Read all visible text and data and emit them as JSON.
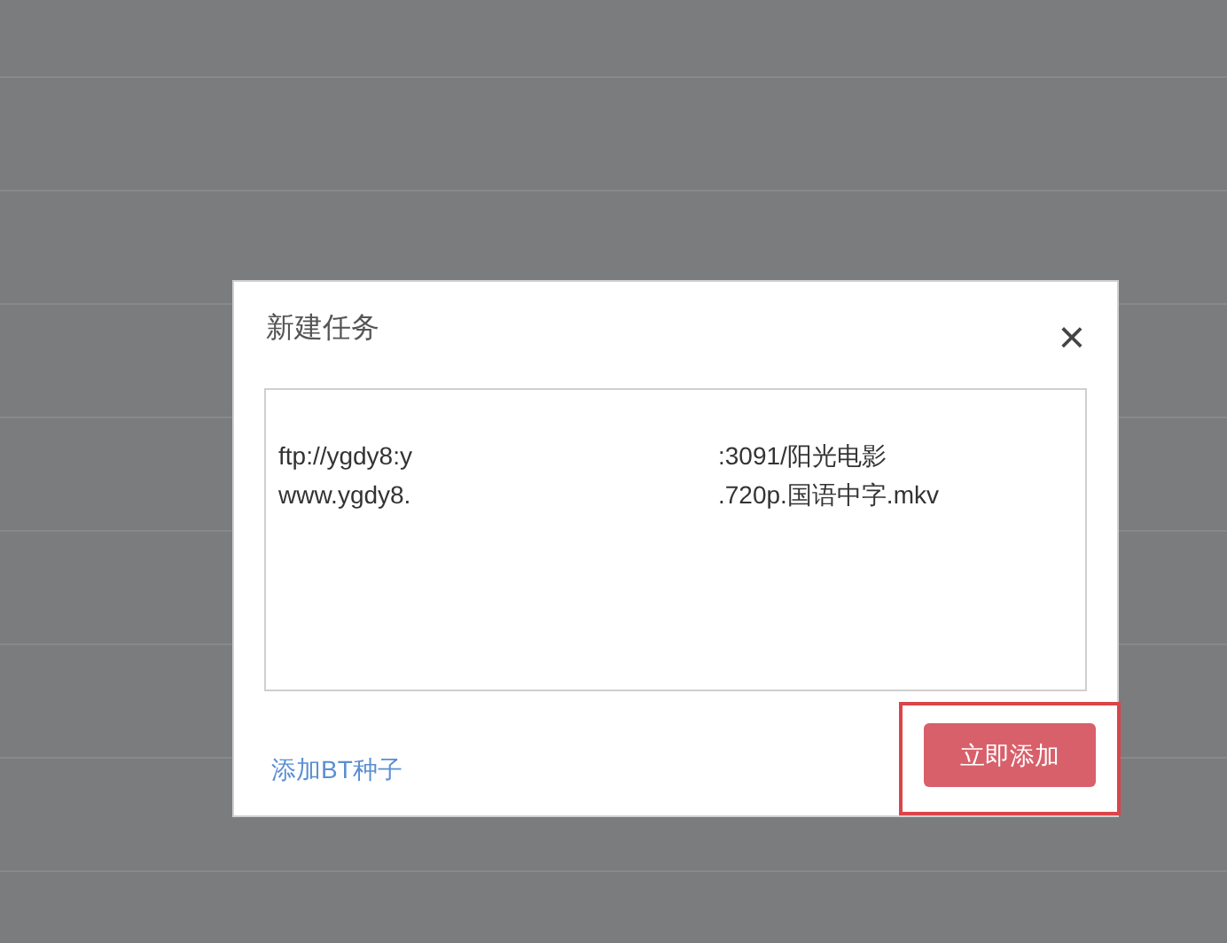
{
  "dialog": {
    "title": "新建任务",
    "close": "×",
    "links": [
      {
        "left": "ftp://ygdy8:y",
        "right": ":3091/阳光电影"
      },
      {
        "left": "www.ygdy8.",
        "right": ".720p.国语中字.mkv"
      }
    ],
    "bt_link": "添加BT种子",
    "submit": "立即添加",
    "highlighted": true
  }
}
